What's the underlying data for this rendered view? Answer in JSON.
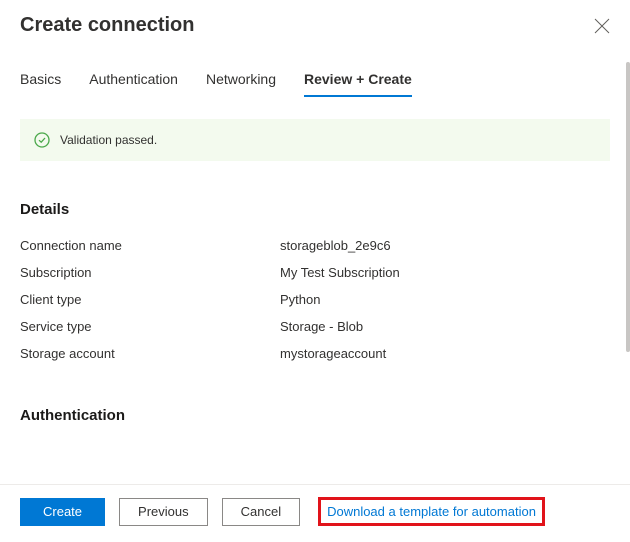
{
  "header": {
    "title": "Create connection"
  },
  "tabs": [
    {
      "label": "Basics"
    },
    {
      "label": "Authentication"
    },
    {
      "label": "Networking"
    },
    {
      "label": "Review + Create"
    }
  ],
  "activeTabIndex": 3,
  "validation": {
    "message": "Validation passed.",
    "icon": "checkmark-circle-icon"
  },
  "sections": [
    {
      "title": "Details",
      "rows": [
        {
          "label": "Connection name",
          "value": "storageblob_2e9c6"
        },
        {
          "label": "Subscription",
          "value": "My Test Subscription"
        },
        {
          "label": "Client type",
          "value": "Python"
        },
        {
          "label": "Service type",
          "value": "Storage - Blob"
        },
        {
          "label": "Storage account",
          "value": "mystorageaccount"
        }
      ]
    },
    {
      "title": "Authentication",
      "rows": []
    }
  ],
  "footer": {
    "create": "Create",
    "previous": "Previous",
    "cancel": "Cancel",
    "downloadTemplate": "Download a template for automation"
  }
}
